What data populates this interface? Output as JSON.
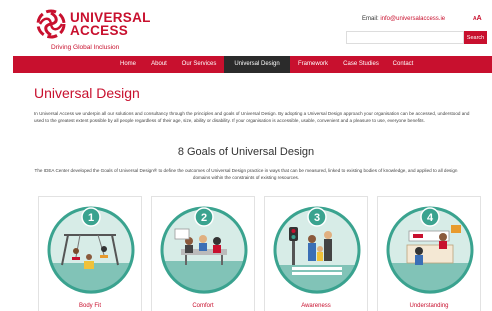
{
  "header": {
    "brand_line1": "UNIVERSAL",
    "brand_line2": "ACCESS",
    "tagline": "Driving Global Inclusion",
    "email_label": "Email:",
    "email_address": "info@universalaccess.ie",
    "text_size_small": "A",
    "text_size_large": "A",
    "search_placeholder": "",
    "search_button": "Search"
  },
  "nav": {
    "items": [
      {
        "label": "Home"
      },
      {
        "label": "About"
      },
      {
        "label": "Our Services"
      },
      {
        "label": "Universal Design",
        "active": true
      },
      {
        "label": "Framework"
      },
      {
        "label": "Case Studies"
      },
      {
        "label": "Contact"
      }
    ]
  },
  "main": {
    "title": "Universal Design",
    "intro": "In Universal Access we underpin all our solutions and consultancy through the principles and goals of Universal Design. By adopting a Universal Design approach your organisation can be accessed, understood and used to the greatest extent possible by all people regardless of their age, size, ability or disability. If your organisation is accessible, usable, convenient and a pleasure to use, everyone benefits.",
    "section_title": "8 Goals of Universal Design",
    "section_desc": "The IDEA Center developed the Goals of Universal Design® to define the outcomes of Universal Design practice in ways that can be measured, linked to existing bodies of knowledge, and applied to all design domains within the constraints of existing resources."
  },
  "goals": [
    {
      "number": "1",
      "label": "Body Fit"
    },
    {
      "number": "2",
      "label": "Comfort"
    },
    {
      "number": "3",
      "label": "Awareness"
    },
    {
      "number": "4",
      "label": "Understanding"
    }
  ],
  "colors": {
    "brand": "#c8102e",
    "teal": "#3aa38f",
    "nav_active": "#2b2b2b"
  }
}
